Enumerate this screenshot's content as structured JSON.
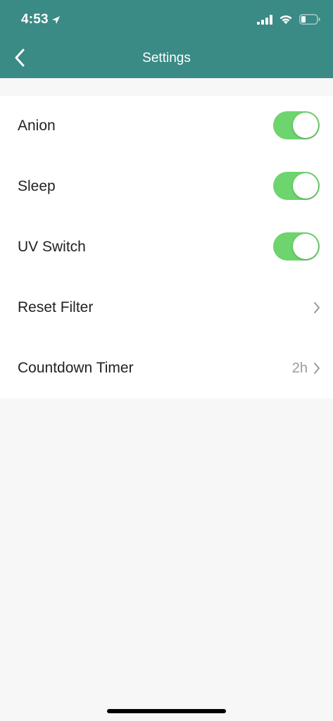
{
  "status_bar": {
    "time": "4:53",
    "location_icon": "location-arrow-icon",
    "signal_icon": "cellular-signal-icon",
    "wifi_icon": "wifi-icon",
    "battery_icon": "battery-low-icon"
  },
  "nav": {
    "title": "Settings",
    "back_icon": "chevron-left-icon"
  },
  "settings": {
    "items": [
      {
        "label": "Anion",
        "type": "toggle",
        "on": true
      },
      {
        "label": "Sleep",
        "type": "toggle",
        "on": true
      },
      {
        "label": "UV Switch",
        "type": "toggle",
        "on": true
      },
      {
        "label": "Reset Filter",
        "type": "link"
      },
      {
        "label": "Countdown Timer",
        "type": "link",
        "value": "2h"
      }
    ]
  },
  "colors": {
    "header": "#3a8a85",
    "toggle_on": "#6ed46e",
    "background": "#f7f7f7",
    "row_background": "#ffffff"
  }
}
